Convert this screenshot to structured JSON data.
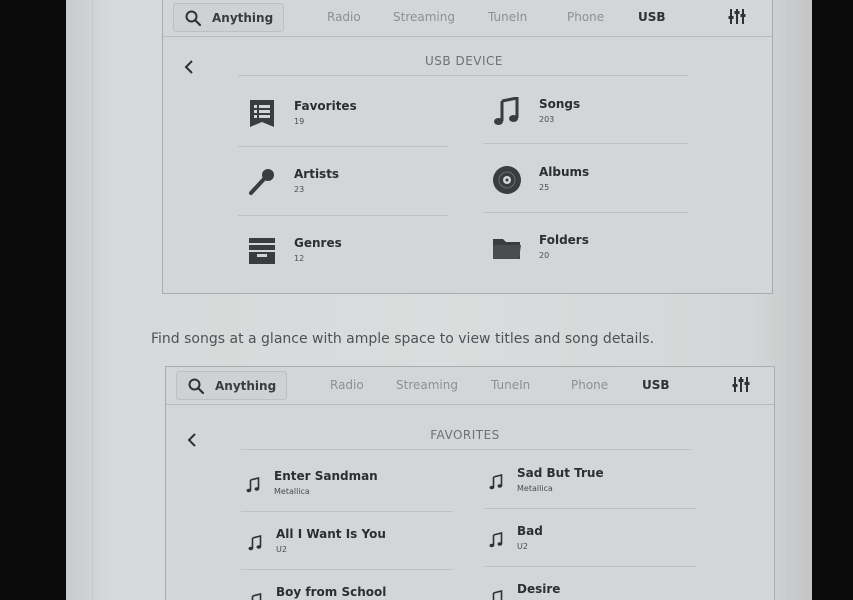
{
  "screen1": {
    "search_label": "Anything",
    "tabs": [
      {
        "label": "Radio"
      },
      {
        "label": "Streaming"
      },
      {
        "label": "TuneIn"
      },
      {
        "label": "Phone"
      },
      {
        "label": "USB"
      }
    ],
    "active_tab": "USB",
    "section_title": "USB DEVICE",
    "categories": [
      {
        "label": "Favorites",
        "count": "19",
        "icon": "favorites-list-icon"
      },
      {
        "label": "Songs",
        "count": "203",
        "icon": "music-note-icon"
      },
      {
        "label": "Artists",
        "count": "23",
        "icon": "microphone-icon"
      },
      {
        "label": "Albums",
        "count": "25",
        "icon": "disc-icon"
      },
      {
        "label": "Genres",
        "count": "12",
        "icon": "archive-box-icon"
      },
      {
        "label": "Folders",
        "count": "20",
        "icon": "folder-icon"
      }
    ]
  },
  "caption": "Find songs at a glance with ample space to view titles and song details.",
  "screen2": {
    "search_label": "Anything",
    "tabs": [
      {
        "label": "Radio"
      },
      {
        "label": "Streaming"
      },
      {
        "label": "TuneIn"
      },
      {
        "label": "Phone"
      },
      {
        "label": "USB"
      }
    ],
    "active_tab": "USB",
    "section_title": "FAVORITES",
    "songs": [
      {
        "title": "Enter Sandman",
        "artist": "Metallica"
      },
      {
        "title": "Sad But True",
        "artist": "Metallica"
      },
      {
        "title": "All I Want Is You",
        "artist": "U2"
      },
      {
        "title": "Bad",
        "artist": "U2"
      },
      {
        "title": "Boy from School",
        "artist": ""
      },
      {
        "title": "Desire",
        "artist": ""
      }
    ]
  }
}
